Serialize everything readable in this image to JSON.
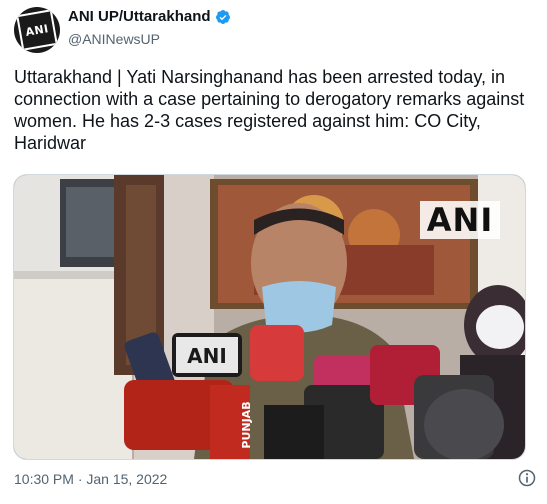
{
  "account": {
    "display_name": "ANI UP/Uttarakhand",
    "handle": "@ANINewsUP",
    "avatar_text": "ANI"
  },
  "tweet": {
    "text": "Uttarakhand | Yati Narsinghanand has been arrested today, in connection with a case pertaining to derogatory remarks against women. He has 2-3 cases registered against him: CO City, Haridwar",
    "timestamp": "10:30 PM · Jan 15, 2022"
  },
  "media": {
    "watermark": "ANI",
    "mic_labels": [
      "ANI",
      "PUNJAB"
    ]
  },
  "colors": {
    "verified": "#1d9bf0",
    "text": "#0f1419",
    "muted": "#536471"
  },
  "icons": {
    "verified": "verified-badge-icon",
    "info": "info-icon"
  }
}
